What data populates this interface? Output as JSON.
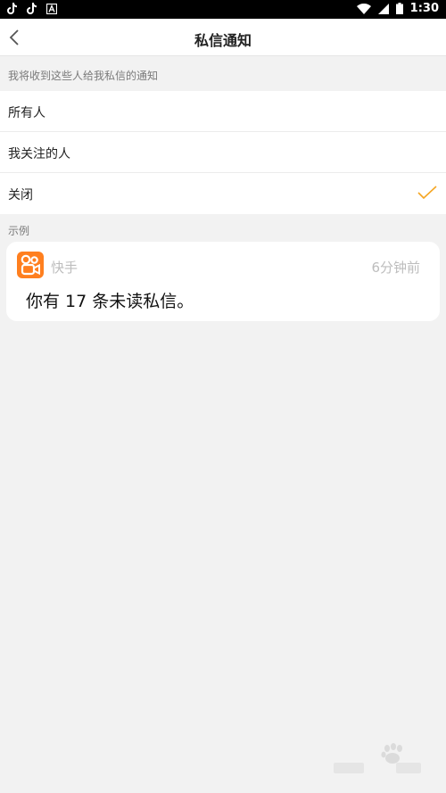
{
  "status_bar": {
    "time": "1:30",
    "left_icons": [
      "tiktok-icon",
      "tiktok-icon",
      "font-icon"
    ],
    "right_icons": [
      "wifi-icon",
      "signal-icon",
      "battery-icon"
    ]
  },
  "header": {
    "title": "私信通知",
    "back_icon": "chevron-left-icon"
  },
  "section": {
    "caption": "我将收到这些人给我私信的通知"
  },
  "options": [
    {
      "label": "所有人",
      "selected": false
    },
    {
      "label": "我关注的人",
      "selected": false
    },
    {
      "label": "关闭",
      "selected": true
    }
  ],
  "example": {
    "caption": "示例",
    "app_name": "快手",
    "time": "6分钟前",
    "message": "你有 17 条未读私信。"
  },
  "colors": {
    "accent": "#ff7f1f",
    "check": "#f5a623",
    "background": "#f2f2f2"
  }
}
